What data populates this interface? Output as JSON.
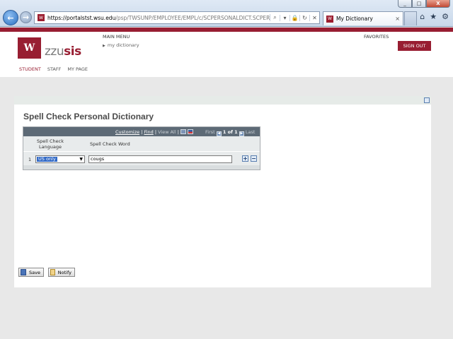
{
  "browser": {
    "url_host": "https://portalstst.wsu.edu",
    "url_path": "/psp/TWSUNP/EMPLOYEE/EMPL/c/SCPERSONALDICT.SCPERSONALI",
    "tab_title": "My Dictionary",
    "tab_close": "×",
    "controls": [
      "⌕",
      "▾",
      "🔒",
      "↻",
      "✕"
    ],
    "window_buttons": [
      "_",
      "□",
      "X"
    ],
    "tool_icons": [
      "home-icon",
      "favorites-icon",
      "settings-icon"
    ]
  },
  "header": {
    "logo_mark": "W",
    "logo_zz": "zzu",
    "logo_sis": "sis",
    "main_menu": "MAIN MENU",
    "breadcrumb": "my dictionary",
    "favorites": "FAVORITES",
    "sign_out": "SIGN OUT",
    "nav": [
      "STUDENT",
      "STAFF",
      "MY PAGE"
    ]
  },
  "page": {
    "title": "Spell Check Personal Dictionary"
  },
  "grid": {
    "customize": "Customize",
    "sep1": " | ",
    "find": "Find",
    "sep2": " | ",
    "view_all": "View All",
    "sep3": " | ",
    "first": "First",
    "range": "1 of 1",
    "last": "Last",
    "col_language": "Spell Check Language",
    "col_word": "Spell Check Word",
    "rows": [
      {
        "num": "1",
        "language": "US only",
        "word": "cougs"
      }
    ]
  },
  "buttons": {
    "save": "Save",
    "notify": "Notify"
  },
  "colors": {
    "brand": "#981e32",
    "grid_header": "#5d6a76",
    "selection": "#3169c6"
  }
}
